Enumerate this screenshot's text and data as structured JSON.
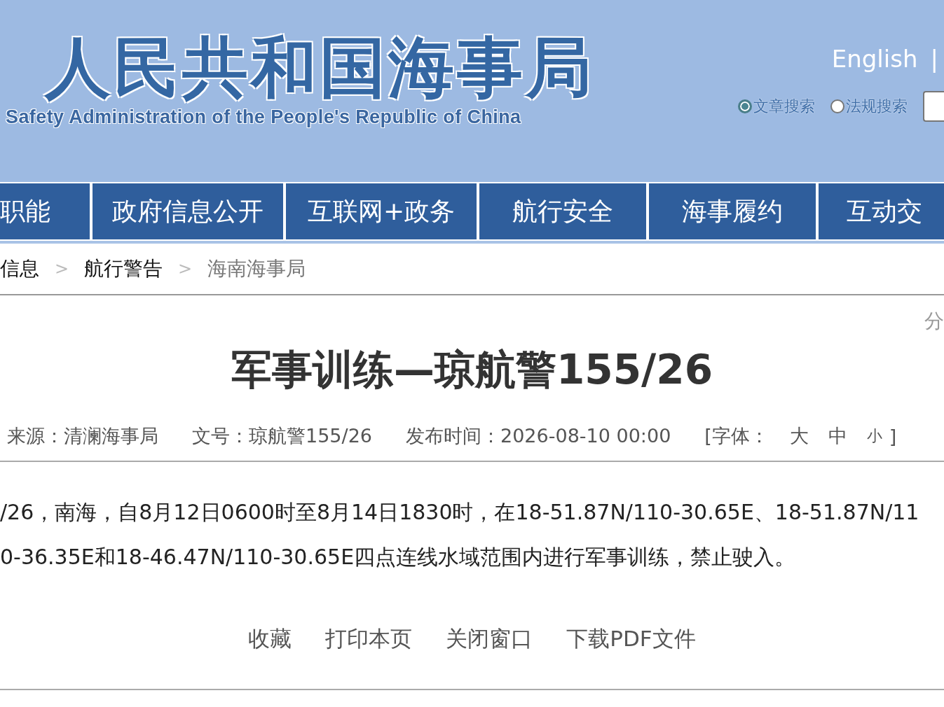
{
  "header": {
    "logo_title": "人民共和国海事局",
    "logo_subtitle": "Safety Administration of the People's Republic of China",
    "language_link": "English",
    "separator": "|",
    "search_options": [
      {
        "label": "文章搜索",
        "selected": true
      },
      {
        "label": "法规搜索",
        "selected": false
      }
    ]
  },
  "nav": {
    "tabs": [
      {
        "label": "职能"
      },
      {
        "label": "政府信息公开"
      },
      {
        "label": "互联网+政务"
      },
      {
        "label": "航行安全"
      },
      {
        "label": "海事履约"
      },
      {
        "label": "互动交"
      }
    ]
  },
  "breadcrumb": {
    "items": [
      {
        "label": "信息",
        "current": false
      },
      {
        "label": "航行警告",
        "current": false
      },
      {
        "label": "海南海事局",
        "current": true
      }
    ],
    "separator": ">"
  },
  "article": {
    "share": "分",
    "title": "军事训练—琼航警155/26",
    "meta": {
      "source": "来源：清澜海事局",
      "number": "文号：琼航警155/26",
      "published": "发布时间：2026-08-10 00:00",
      "font_label": "[字体：",
      "font_sizes": [
        "大",
        "中",
        "小"
      ],
      "font_close": "]"
    },
    "body": [
      "/26，南海，自8月12日0600时至8月14日1830时，在18-51.87N/110-30.65E、18-51.87N/11",
      "0-36.35E和18-46.47N/110-30.65E四点连线水域范围内进行军事训练，禁止驶入。"
    ],
    "actions": [
      "收藏",
      "打印本页",
      "关闭窗口",
      "下载PDF文件"
    ]
  }
}
